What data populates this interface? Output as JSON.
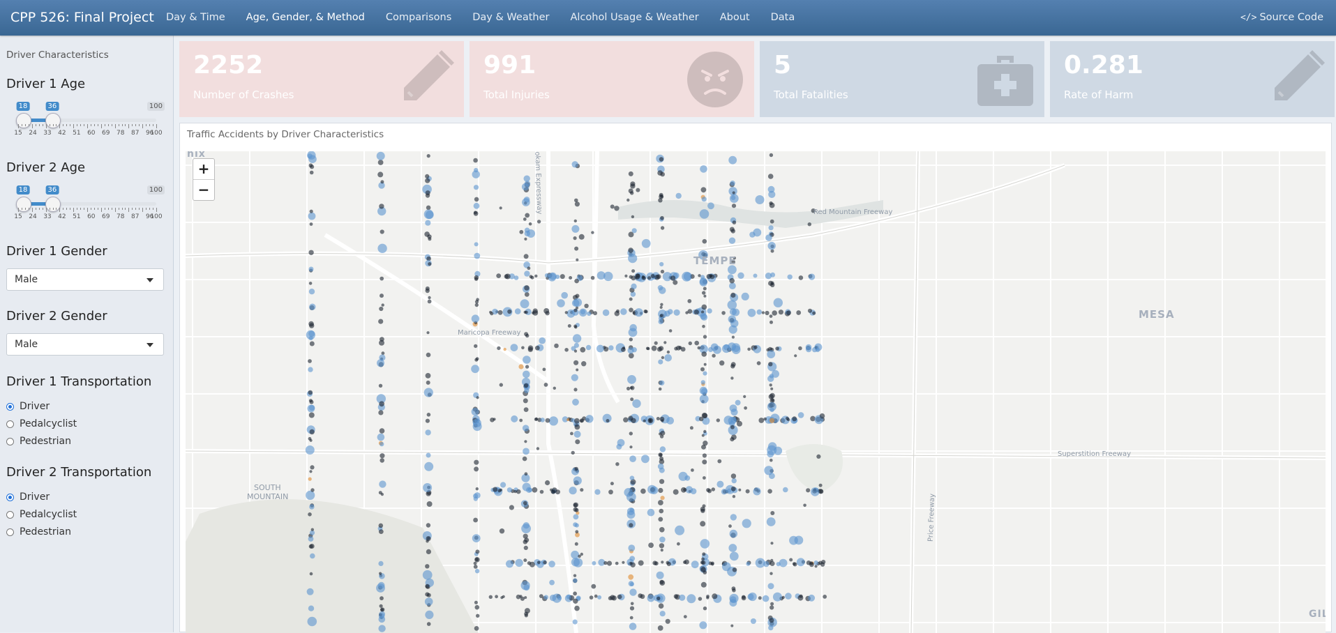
{
  "header": {
    "brand": "CPP 526: Final Project",
    "nav": [
      "Day & Time",
      "Age, Gender, & Method",
      "Comparisons",
      "Day & Weather",
      "Alcohol Usage & Weather",
      "About",
      "Data"
    ],
    "active_tab": "Age, Gender, & Method",
    "source_code": "Source Code",
    "source_icon": "code-icon"
  },
  "sidebar": {
    "title": "Driver Characteristics",
    "driver1_age": {
      "label": "Driver 1 Age",
      "min": 15,
      "max": 100,
      "from": 18,
      "to": 36,
      "max_label": "100",
      "ticks": [
        "15",
        "24",
        "33",
        "42",
        "51",
        "60",
        "69",
        "78",
        "87",
        "96",
        "100"
      ]
    },
    "driver2_age": {
      "label": "Driver 2 Age",
      "min": 15,
      "max": 100,
      "from": 18,
      "to": 36,
      "max_label": "100",
      "ticks": [
        "15",
        "24",
        "33",
        "42",
        "51",
        "60",
        "69",
        "78",
        "87",
        "96",
        "100"
      ]
    },
    "driver1_gender": {
      "label": "Driver 1 Gender",
      "value": "Male"
    },
    "driver2_gender": {
      "label": "Driver 2 Gender",
      "value": "Male"
    },
    "driver1_transport": {
      "label": "Driver 1 Transportation",
      "options": [
        "Driver",
        "Pedalcyclist",
        "Pedestrian"
      ],
      "selected": "Driver"
    },
    "driver2_transport": {
      "label": "Driver 2 Transportation",
      "options": [
        "Driver",
        "Pedalcyclist",
        "Pedestrian"
      ],
      "selected": "Driver"
    }
  },
  "value_boxes": [
    {
      "value": "2252",
      "label": "Number of Crashes",
      "icon": "pencil-icon",
      "color": "#f2dede"
    },
    {
      "value": "991",
      "label": "Total Injuries",
      "icon": "angry-face-icon",
      "color": "#f2dede"
    },
    {
      "value": "5",
      "label": "Total Fatalities",
      "icon": "medkit-icon",
      "color": "#cfd9e4"
    },
    {
      "value": "0.281",
      "label": "Rate of Harm",
      "icon": "pencil-icon",
      "color": "#cfd9e4"
    }
  ],
  "map_panel": {
    "title": "Traffic Accidents by Driver Characteristics",
    "zoom_in": "+",
    "zoom_out": "−",
    "place_labels": [
      "TEMPE",
      "MESA",
      "SOUTH",
      "MOUNTAIN",
      "GILE",
      "nix"
    ],
    "road_labels": [
      "Red Mountain Freeway",
      "Maricopa Freeway",
      "Superstition Freeway",
      "Price Freeway",
      "Hohokam Expressway"
    ],
    "colors": {
      "point_dark": "#1d2530",
      "point_blue": "#5b95cf",
      "point_orange": "#e08a2e"
    }
  }
}
